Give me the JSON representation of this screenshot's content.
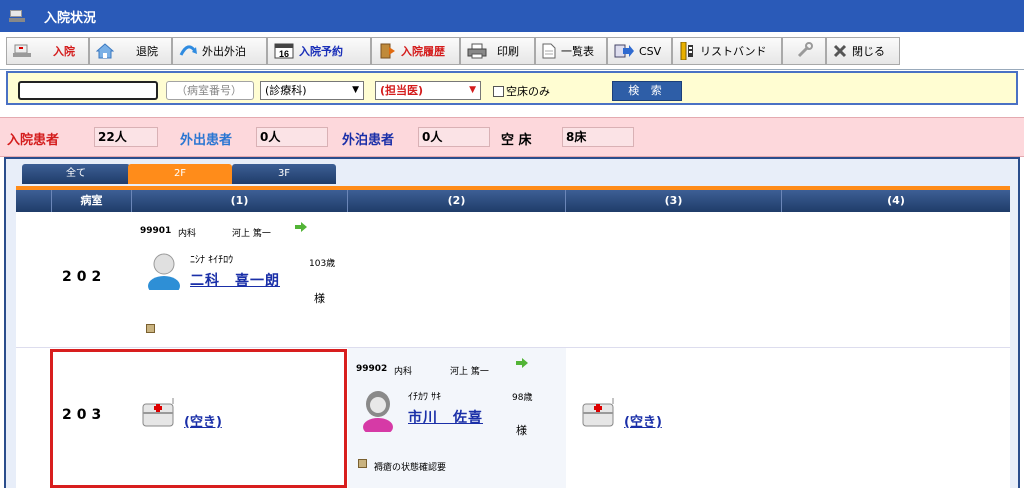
{
  "window": {
    "title": "入院状況"
  },
  "toolbar": {
    "admission": "入院",
    "discharge": "退院",
    "outing": "外出外泊",
    "reservation": "入院予約",
    "history": "入院履歴",
    "print": "印刷",
    "list": "一覧表",
    "csv": "CSV",
    "wristband": "リストバンド",
    "close": "閉じる",
    "calendar_day": "16"
  },
  "search": {
    "room_value": "",
    "room_placeholder": "（病室番号）",
    "dept_select": "(診療科)",
    "doctor_select": "(担当医)",
    "empty_only_label": "空床のみ",
    "search_button": "検 索"
  },
  "stats": {
    "inpatients_label": "入院患者",
    "inpatients_value": "22人",
    "outing_label": "外出患者",
    "outing_value": "0人",
    "overnight_label": "外泊患者",
    "overnight_value": "0人",
    "empty_label": "空 床",
    "empty_value": "8床"
  },
  "tabs": [
    "全て",
    "2F",
    "3F"
  ],
  "table": {
    "columns": [
      "病室",
      "(1)",
      "(2)",
      "(3)",
      "(4)"
    ],
    "rows": [
      {
        "room": "202",
        "beds": [
          {
            "id": "99901",
            "dept": "内科",
            "doctor": "河上 篤一",
            "kana": "ﾆｼﾅ ｷｲﾁﾛｳ",
            "age": "103歳",
            "name": "二科　喜一朗",
            "honorific": "様",
            "memo": ""
          }
        ]
      },
      {
        "room": "203",
        "beds": [
          {
            "empty_label": "(空き)"
          },
          {
            "id": "99902",
            "dept": "内科",
            "doctor": "河上 篤一",
            "kana": "ｲﾁｶﾜ ｻｷ",
            "age": "98歳",
            "name": "市川　佐喜",
            "honorific": "様",
            "memo": "褥瘡の状態確認要"
          },
          {
            "empty_label": "(空き)"
          }
        ]
      }
    ]
  },
  "colors": {
    "title_bar": "#2a5ab8",
    "tab_active": "#ff8c1a",
    "header_dark": "#1f3c69",
    "stats_bg": "#fdd8dc",
    "search_bg": "#fffdd2",
    "link": "#1a2fa8",
    "highlight": "#d81e1e"
  }
}
